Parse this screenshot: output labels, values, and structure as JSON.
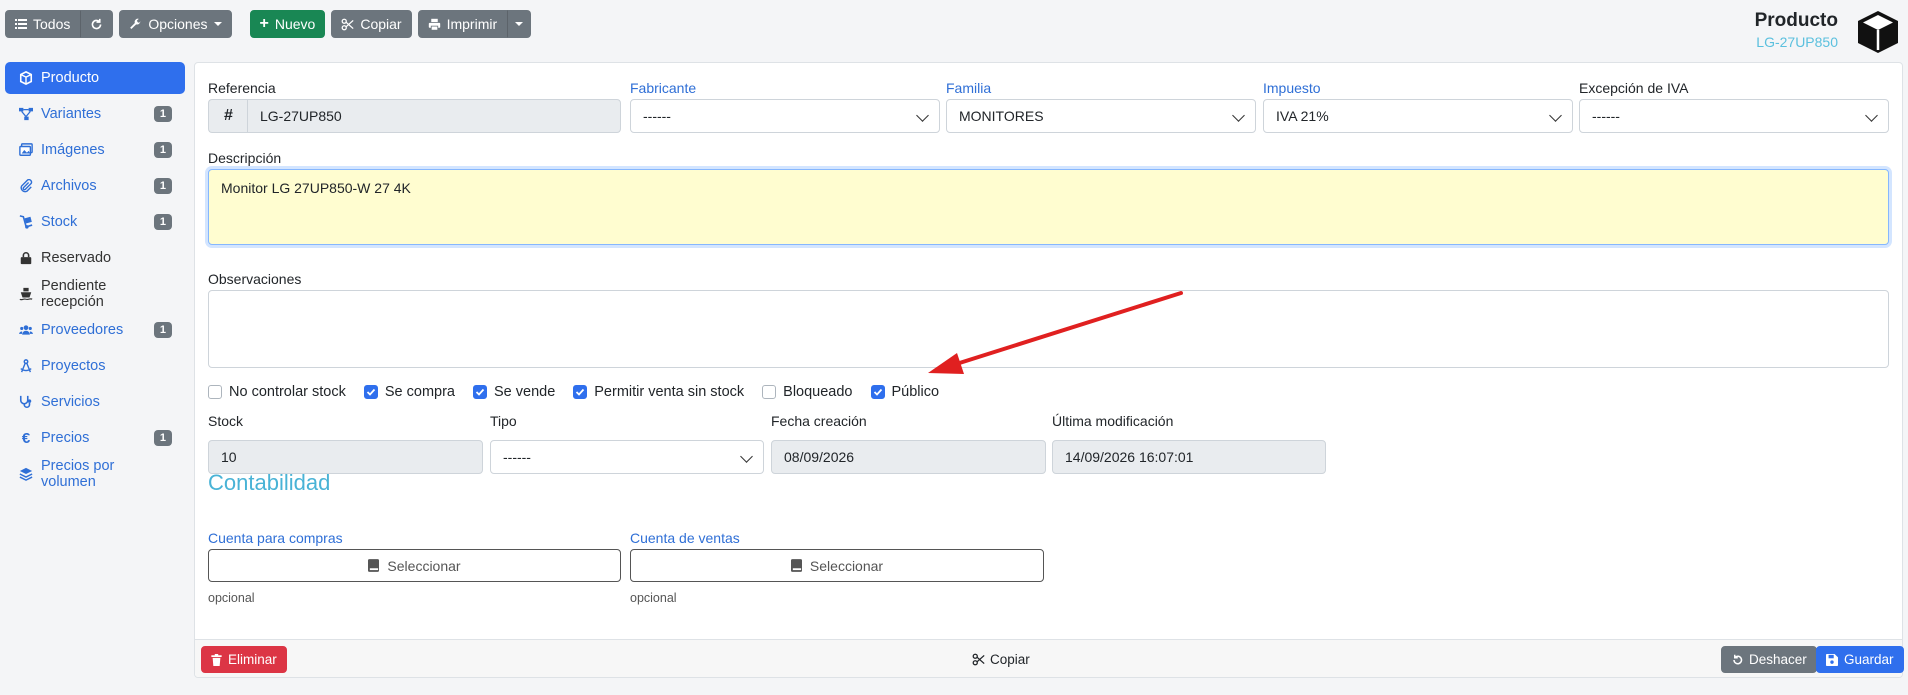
{
  "toolbar": {
    "all_label": "Todos",
    "options_label": "Opciones",
    "new_label": "Nuevo",
    "copy_label": "Copiar",
    "print_label": "Imprimir"
  },
  "header": {
    "title": "Producto",
    "subtitle": "LG-27UP850"
  },
  "sidebar": {
    "items": [
      {
        "label": "Producto",
        "badge": ""
      },
      {
        "label": "Variantes",
        "badge": "1"
      },
      {
        "label": "Imágenes",
        "badge": "1"
      },
      {
        "label": "Archivos",
        "badge": "1"
      },
      {
        "label": "Stock",
        "badge": "1"
      },
      {
        "label": "Reservado",
        "badge": ""
      },
      {
        "label": "Pendiente recepción",
        "badge": ""
      },
      {
        "label": "Proveedores",
        "badge": "1"
      },
      {
        "label": "Proyectos",
        "badge": ""
      },
      {
        "label": "Servicios",
        "badge": ""
      },
      {
        "label": "Precios",
        "badge": "1"
      },
      {
        "label": "Precios por volumen",
        "badge": ""
      }
    ]
  },
  "form": {
    "referencia_label": "Referencia",
    "referencia_value": "LG-27UP850",
    "referencia_prefix": "#",
    "fabricante_label": "Fabricante",
    "fabricante_value": "------",
    "familia_label": "Familia",
    "familia_value": "MONITORES",
    "impuesto_label": "Impuesto",
    "impuesto_value": "IVA 21%",
    "excepcion_label": "Excepción de IVA",
    "excepcion_value": "------",
    "descripcion_label": "Descripción",
    "descripcion_value": "Monitor LG 27UP850-W 27 4K",
    "observaciones_label": "Observaciones",
    "observaciones_value": "",
    "checks": [
      {
        "label": "No controlar stock",
        "checked": false
      },
      {
        "label": "Se compra",
        "checked": true
      },
      {
        "label": "Se vende",
        "checked": true
      },
      {
        "label": "Permitir venta sin stock",
        "checked": true
      },
      {
        "label": "Bloqueado",
        "checked": false
      },
      {
        "label": "Público",
        "checked": true
      }
    ],
    "stock_label": "Stock",
    "stock_value": "10",
    "tipo_label": "Tipo",
    "tipo_value": "------",
    "fecha_label": "Fecha creación",
    "fecha_value": "08/09/2026",
    "ultima_label": "Última modificación",
    "ultima_value": "14/09/2026 16:07:01",
    "contabilidad_title": "Contabilidad",
    "cuenta_compras_label": "Cuenta para compras",
    "cuenta_ventas_label": "Cuenta de ventas",
    "select_label": "Seleccionar",
    "optional_hint": "opcional"
  },
  "footer": {
    "delete_label": "Eliminar",
    "copy_label": "Copiar",
    "undo_label": "Deshacer",
    "save_label": "Guardar"
  },
  "colors": {
    "primary": "#2f6fed",
    "success": "#198754",
    "danger": "#dc3545",
    "secondary": "#6c757d",
    "annotation_arrow": "#e02020"
  }
}
